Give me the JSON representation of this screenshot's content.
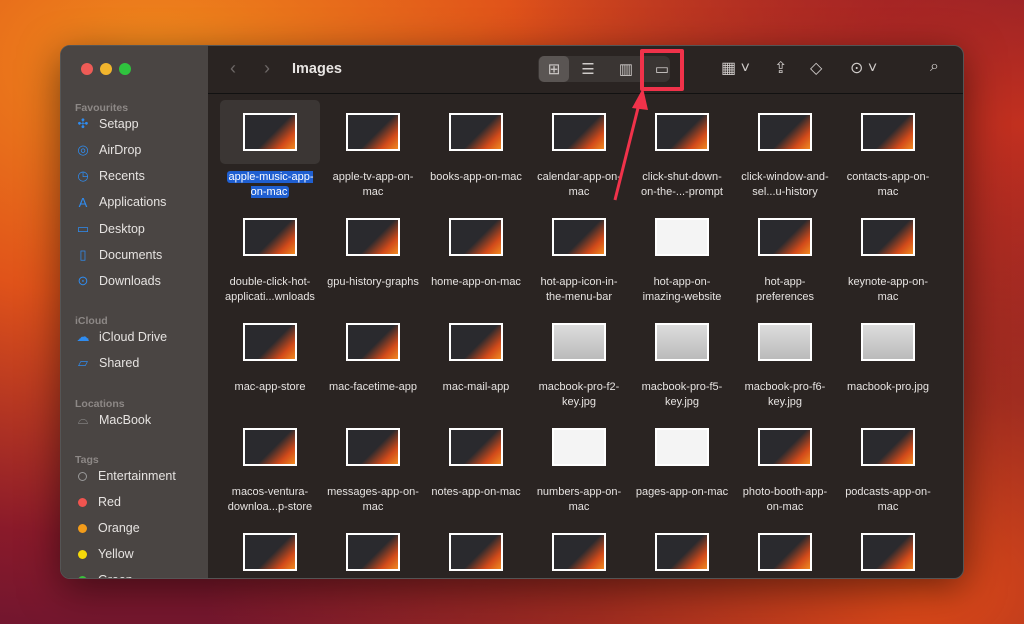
{
  "window": {
    "title": "Images"
  },
  "sidebar": {
    "sections": [
      {
        "label": "Favourites",
        "items": [
          {
            "label": "Setapp",
            "icon": "setapp-icon"
          },
          {
            "label": "AirDrop",
            "icon": "airdrop-icon"
          },
          {
            "label": "Recents",
            "icon": "clock-icon"
          },
          {
            "label": "Applications",
            "icon": "applications-icon"
          },
          {
            "label": "Desktop",
            "icon": "desktop-icon"
          },
          {
            "label": "Documents",
            "icon": "document-icon"
          },
          {
            "label": "Downloads",
            "icon": "download-icon"
          }
        ]
      },
      {
        "label": "iCloud",
        "items": [
          {
            "label": "iCloud Drive",
            "icon": "cloud-icon"
          },
          {
            "label": "Shared",
            "icon": "shared-folder-icon"
          }
        ]
      },
      {
        "label": "Locations",
        "items": [
          {
            "label": "MacBook",
            "icon": "disk-icon"
          }
        ]
      },
      {
        "label": "Tags",
        "items": [
          {
            "label": "Entertainment",
            "color": ""
          },
          {
            "label": "Red",
            "color": "#f0544f"
          },
          {
            "label": "Orange",
            "color": "#f39c1a"
          },
          {
            "label": "Yellow",
            "color": "#f5d90a"
          },
          {
            "label": "Green",
            "color": "#3bc13b"
          }
        ]
      }
    ]
  },
  "toolbar": {
    "views": [
      "icon-view",
      "list-view",
      "column-view",
      "gallery-view"
    ],
    "active_view": "icon-view",
    "highlighted": "gallery-view"
  },
  "files": [
    "apple-music-app-on-mac",
    "apple-tv-app-on-mac",
    "books-app-on-mac",
    "calendar-app-on-mac",
    "click-shut-down-on-the-...-prompt",
    "click-window-and-sel...u-history",
    "contacts-app-on-mac",
    "double-click-hot-applicati...wnloads",
    "gpu-history-graphs",
    "home-app-on-mac",
    "hot-app-icon-in-the-menu-bar",
    "hot-app-on-imazing-website",
    "hot-app-preferences",
    "keynote-app-on-mac",
    "mac-app-store",
    "mac-facetime-app",
    "mac-mail-app",
    "macbook-pro-f2-key.jpg",
    "macbook-pro-f5-key.jpg",
    "macbook-pro-f6-key.jpg",
    "macbook-pro.jpg",
    "macos-ventura-downloa...p-store",
    "messages-app-on-mac",
    "notes-app-on-mac",
    "numbers-app-on-mac",
    "pages-app-on-mac",
    "photo-booth-app-on-mac",
    "podcasts-app-on-mac",
    "",
    "",
    "",
    "",
    "",
    "",
    ""
  ],
  "selected_index": 0,
  "colors": {
    "accent": "#1f5fd1",
    "highlight": "#f0324a"
  }
}
